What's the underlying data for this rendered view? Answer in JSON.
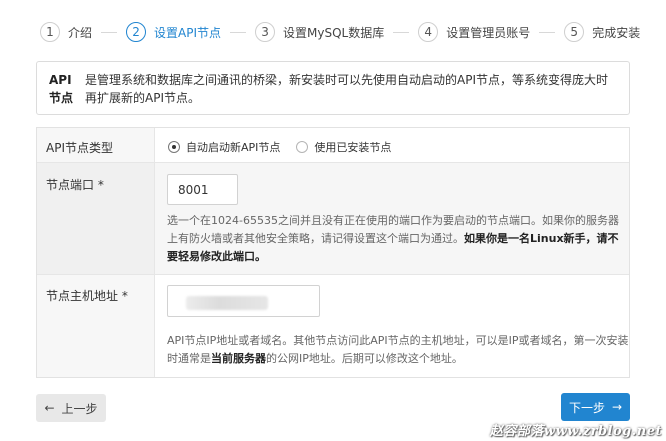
{
  "steps": [
    {
      "num": "1",
      "label": "介绍"
    },
    {
      "num": "2",
      "label": "设置API节点"
    },
    {
      "num": "3",
      "label": "设置MySQL数据库"
    },
    {
      "num": "4",
      "label": "设置管理员账号"
    },
    {
      "num": "5",
      "label": "完成安装"
    }
  ],
  "active_step": 2,
  "info": {
    "title": "API节点",
    "text": "是管理系统和数据库之间通讯的桥梁，新安装时可以先使用自动启动的API节点，等系统变得庞大时再扩展新的API节点。"
  },
  "form": {
    "type_row": {
      "label": "API节点类型",
      "options": [
        "自动启动新API节点",
        "使用已安装节点"
      ],
      "selected": "自动启动新API节点"
    },
    "port_row": {
      "label": "节点端口 *",
      "value": "8001",
      "help_part1": "选一个在1024-65535之间并且没有正在使用的端口作为要启动的节点端口。如果你的服务器上有防火墙或者其他安全策略，请记得设置这个端口为通过。",
      "help_bold": "如果你是一名Linux新手，请不要轻易修改此端口。"
    },
    "host_row": {
      "label": "节点主机地址 *",
      "help_part1": "API节点IP地址或者域名。其他节点访问此API节点的主机地址，可以是IP或者域名，第一次安装时通常是",
      "help_bold": "当前服务器",
      "help_part2": "的公网IP地址。后期可以修改这个地址。"
    }
  },
  "buttons": {
    "prev": "上一步",
    "next": "下一步"
  },
  "icons": {
    "prev": "arrow-left-icon",
    "next": "arrow-right-icon"
  },
  "colors": {
    "accent": "#2185d0"
  },
  "watermark": "赵容部落www.zrblog.net"
}
